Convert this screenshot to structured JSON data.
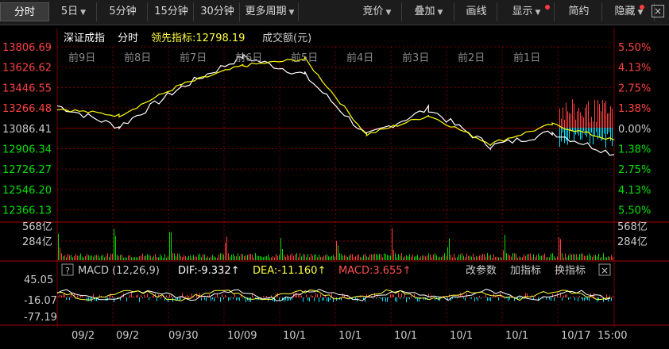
{
  "toolbar": {
    "left": [
      {
        "label": "分时",
        "active": true
      },
      {
        "label": "5日",
        "arrow": true
      },
      {
        "label": "5分钟"
      },
      {
        "label": "15分钟"
      },
      {
        "label": "30分钟"
      },
      {
        "label": "更多周期",
        "arrow": true
      }
    ],
    "right": [
      {
        "label": "竞价",
        "arrow": true
      },
      {
        "label": "叠加",
        "arrow": true
      },
      {
        "label": "画线"
      },
      {
        "label": "显示",
        "arrow": true
      },
      {
        "label": "简约"
      },
      {
        "label": "隐藏",
        "arrow": true
      }
    ],
    "close": "×"
  },
  "header": {
    "index_name": "深证成指",
    "mode": "分时",
    "leading_label": "领先指标:12798.19",
    "volume_label": "成交额(元)"
  },
  "price_axis": {
    "left": [
      "13806.69",
      "13626.62",
      "13446.55",
      "13266.48",
      "13086.41",
      "12906.34",
      "12726.27",
      "12546.20",
      "12366.13"
    ],
    "right": [
      "5.50%",
      "4.13%",
      "2.75%",
      "1.38%",
      "0.00%",
      "1.38%",
      "2.75%",
      "4.13%",
      "5.50%"
    ]
  },
  "day_labels": [
    "前9日",
    "前8日",
    "前7日",
    "前6日",
    "前5日",
    "前4日",
    "前3日",
    "前2日",
    "前1日"
  ],
  "volume_axis": {
    "left": [
      "568亿",
      "284亿"
    ],
    "right": [
      "568亿",
      "284亿"
    ]
  },
  "macd_header": {
    "help": "?",
    "name": "MACD (12,26,9)",
    "dif": "DIF:-9.332↑",
    "dea": "DEA:-11.160↑",
    "macd": "MACD:3.655↑",
    "edit": "改参数",
    "add": "加指标",
    "switch": "换指标",
    "close": "×"
  },
  "macd_axis": [
    "45.05",
    "-16.07",
    "-77.19"
  ],
  "date_axis": [
    "09/2",
    "09/2",
    "09/30",
    "10/09",
    "10/1",
    "10/1",
    "10/1",
    "10/1",
    "10/1",
    "10/17",
    "15:00"
  ],
  "colors": {
    "up": "#ff4040",
    "down": "#00e000",
    "price_line": "#ffffff",
    "avg_line": "#ffff00",
    "macd_cyan": "#00e5ff",
    "grid": "#7a0000"
  },
  "chart_data": {
    "type": "line",
    "title": "深证成指",
    "ylim": [
      12366.13,
      13806.69
    ],
    "x": [
      "前9日",
      "前8日",
      "前7日",
      "前6日",
      "前5日",
      "前4日",
      "前3日",
      "前2日",
      "前1日",
      "10/17"
    ],
    "series": [
      {
        "name": "",
        "values": [
          13286,
          13100,
          13450,
          13720,
          13560,
          13020,
          13260,
          12930,
          13050,
          12860
        ]
      },
      {
        "name": "",
        "values": [
          13260,
          13200,
          13470,
          13640,
          13700,
          13030,
          13200,
          12950,
          13120,
          12980
        ]
      }
    ]
  }
}
